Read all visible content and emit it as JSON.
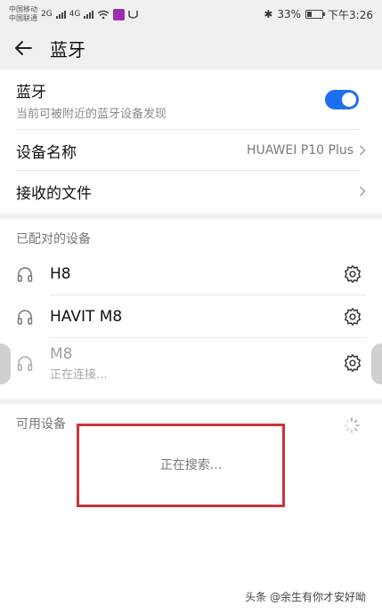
{
  "status_bar": {
    "carrier_1": "中国移动",
    "carrier_2": "中国联通",
    "net_1": "2G",
    "net_2": "4G",
    "bluetooth_glyph": "✱",
    "battery_percent": "33%",
    "battery_level": 0.33,
    "time": "下午3:26"
  },
  "header": {
    "title": "蓝牙"
  },
  "settings": {
    "bluetooth_label": "蓝牙",
    "bluetooth_sub": "当前可被附近的蓝牙设备发现",
    "bluetooth_on": true,
    "device_name_label": "设备名称",
    "device_name_value": "HUAWEI P10 Plus",
    "received_files_label": "接收的文件"
  },
  "paired": {
    "section_title": "已配对的设备",
    "devices": [
      {
        "name": "H8",
        "status": ""
      },
      {
        "name": "HAVIT M8",
        "status": ""
      },
      {
        "name": "M8",
        "status": "正在连接..."
      }
    ]
  },
  "available": {
    "section_title": "可用设备",
    "searching_text": "正在搜索..."
  },
  "watermark": "头条 @余生有你才安好呦",
  "colors": {
    "accent": "#1e6ff0",
    "highlight_box": "#c9353a"
  },
  "icons": {
    "back": "arrow-left-icon",
    "headphones": "headphones-icon",
    "settings": "gear-icon",
    "chevron": "chevron-right-icon",
    "loading": "spinner-icon"
  }
}
